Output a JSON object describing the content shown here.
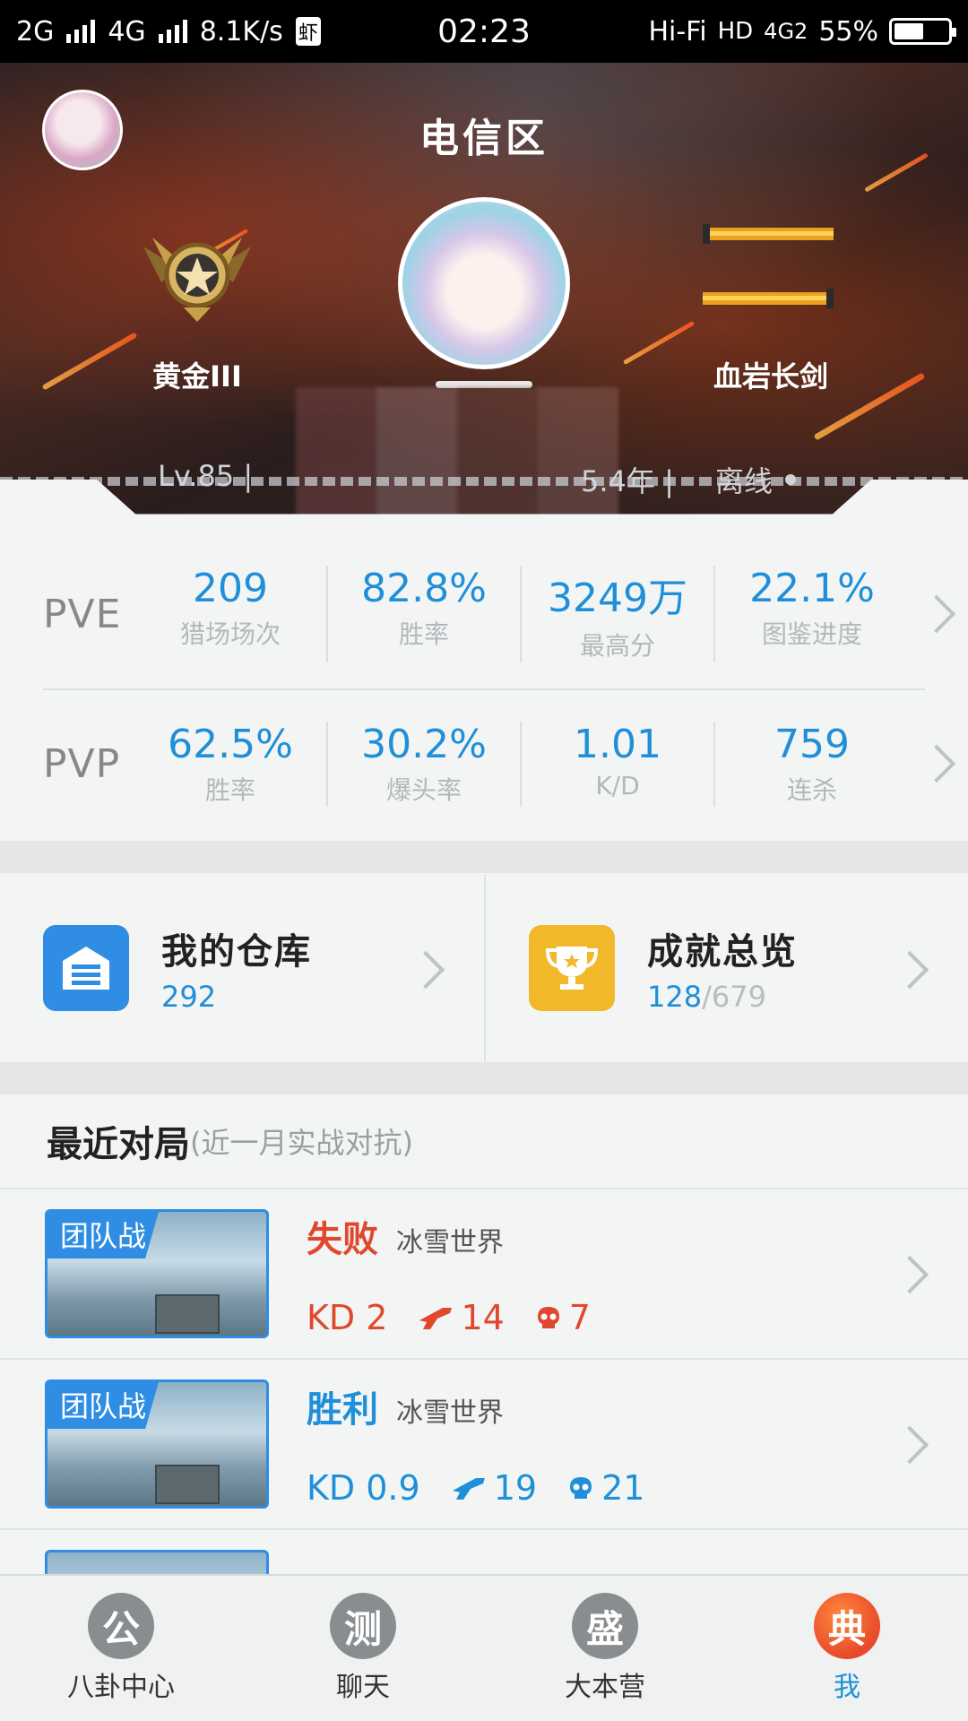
{
  "status_bar": {
    "network1": "2G",
    "network2": "4G",
    "speed": "8.1K/s",
    "app_badge": "虾",
    "time": "02:23",
    "hifi": "Hi-Fi",
    "hd": "HD",
    "net3": "4G2",
    "battery": "55%",
    "battery_level": 0.55
  },
  "header": {
    "server": "电信区",
    "rank_label": "黄金III",
    "weapon_label": "血岩长剑",
    "level": "Lv.85  |",
    "years": "5.4年  |",
    "online_status": "离线"
  },
  "pve": {
    "tag": "PVE",
    "stats": [
      {
        "value": "209",
        "label": "猎场场次"
      },
      {
        "value": "82.8%",
        "label": "胜率"
      },
      {
        "value": "3249万",
        "label": "最高分"
      },
      {
        "value": "22.1%",
        "label": "图鉴进度"
      }
    ]
  },
  "pvp": {
    "tag": "PVP",
    "stats": [
      {
        "value": "62.5%",
        "label": "胜率"
      },
      {
        "value": "30.2%",
        "label": "爆头率"
      },
      {
        "value": "1.01",
        "label": "K/D"
      },
      {
        "value": "759",
        "label": "连杀"
      }
    ]
  },
  "tiles": {
    "warehouse": {
      "title": "我的仓库",
      "count": "292"
    },
    "achievements": {
      "title": "成就总览",
      "count": "128",
      "total": "/679"
    }
  },
  "recent": {
    "title": "最近对局",
    "subtitle": "(近一月实战对抗)",
    "matches": [
      {
        "mode": "团队战",
        "result": "失败",
        "map": "冰雪世界",
        "kd": "KD 2",
        "kills": "14",
        "deaths": "7"
      },
      {
        "mode": "团队战",
        "result": "胜利",
        "map": "冰雪世界",
        "kd": "KD 0.9",
        "kills": "19",
        "deaths": "21"
      }
    ]
  },
  "tabs": [
    {
      "icon": "公",
      "label": "八卦中心"
    },
    {
      "icon": "测",
      "label": "聊天"
    },
    {
      "icon": "盛",
      "label": "大本营"
    },
    {
      "icon": "典",
      "label": "我"
    }
  ],
  "colors": {
    "accent_blue": "#1e8fd8",
    "lose_red": "#e0482e",
    "warehouse_icon": "#2f8de4",
    "trophy_icon": "#f1b82a"
  }
}
